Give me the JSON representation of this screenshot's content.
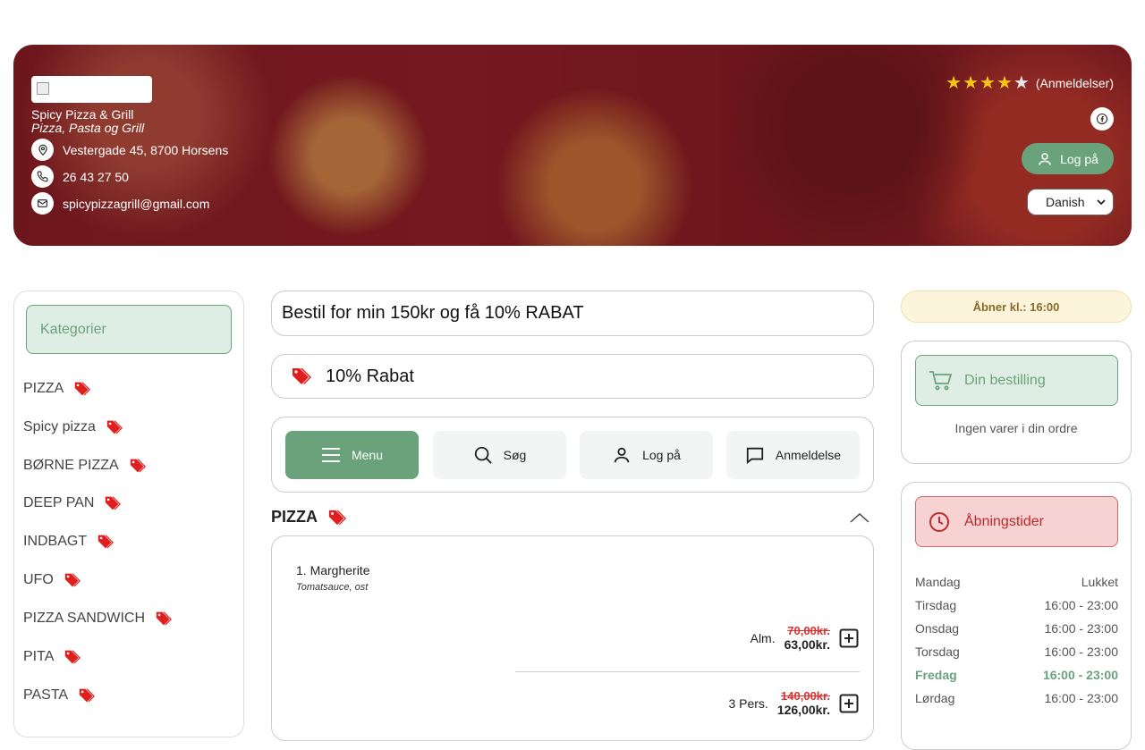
{
  "store": {
    "name": "Spicy Pizza & Grill",
    "subtitle": "Pizza, Pasta og Grill",
    "address": "Vestergade 45, 8700 Horsens",
    "phone": "26 43 27 50",
    "email": "spicypizzagrill@gmail.com",
    "rating": 4,
    "rating_label": "(Anmeldelser)",
    "login_label": "Log på",
    "language": "Danish"
  },
  "sidebar": {
    "header": "Kategorier",
    "categories": [
      "PIZZA",
      "Spicy pizza",
      "BØRNE PIZZA",
      "DEEP PAN",
      "INDBAGT",
      "UFO",
      "PIZZA SANDWICH",
      "PITA",
      "PASTA"
    ]
  },
  "promos": {
    "banner": "Bestil for min 150kr og få 10% RABAT",
    "discount": "10% Rabat"
  },
  "nav": {
    "menu": "Menu",
    "search": "Søg",
    "login": "Log på",
    "review": "Anmeldelse"
  },
  "section": {
    "title": "PIZZA"
  },
  "product": {
    "name": "1. Margherite",
    "description": "Tomatsauce, ost",
    "variants": [
      {
        "size": "Alm.",
        "old_price": "70,00kr.",
        "price": "63,00kr."
      },
      {
        "size": "3 Pers.",
        "old_price": "140,00kr.",
        "price": "126,00kr."
      }
    ]
  },
  "order": {
    "opens": "Åbner kl.: 16:00",
    "title": "Din bestilling",
    "empty": "Ingen varer i din ordre"
  },
  "hours": {
    "title": "Åbningstider",
    "days": [
      {
        "day": "Mandag",
        "time": "Lukket"
      },
      {
        "day": "Tirsdag",
        "time": "16:00 - 23:00"
      },
      {
        "day": "Onsdag",
        "time": "16:00 - 23:00"
      },
      {
        "day": "Torsdag",
        "time": "16:00 - 23:00"
      },
      {
        "day": "Fredag",
        "time": "16:00 - 23:00"
      },
      {
        "day": "Lørdag",
        "time": "16:00 - 23:00"
      }
    ],
    "today": "Fredag"
  },
  "colors": {
    "accent": "#6aa37b",
    "tag": "#e01e1e",
    "hero_overlay": "#6e141c"
  }
}
